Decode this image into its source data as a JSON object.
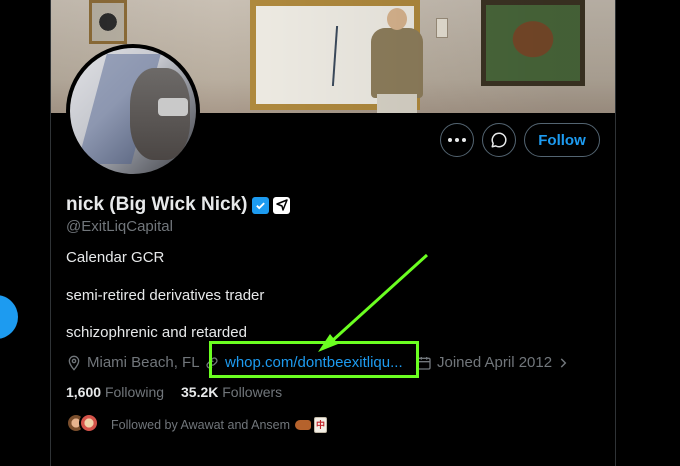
{
  "profile": {
    "display_name": "nick (Big Wick Nick)",
    "handle": "@ExitLiqCapital",
    "bio": [
      "Calendar GCR",
      "semi-retired derivatives trader",
      "schizophrenic and retarded"
    ],
    "location": "Miami Beach, FL",
    "website": "whop.com/dontbeexitliqu...",
    "joined": "Joined April 2012",
    "following_count": "1,600",
    "following_label": "Following",
    "followers_count": "35.2K",
    "followers_label": "Followers",
    "followed_by": "Followed by Awawat and Ansem",
    "verified_badge": "verified-icon",
    "affiliate_badge": "affiliate-icon"
  },
  "actions": {
    "more_label": "more-icon",
    "message_label": "message-icon",
    "follow_label": "Follow"
  },
  "annotation": {
    "color": "#6bff21"
  },
  "colors": {
    "accent": "#1d9bf0",
    "text": "#e7e9ea",
    "muted": "#71767b",
    "background": "#000000"
  }
}
